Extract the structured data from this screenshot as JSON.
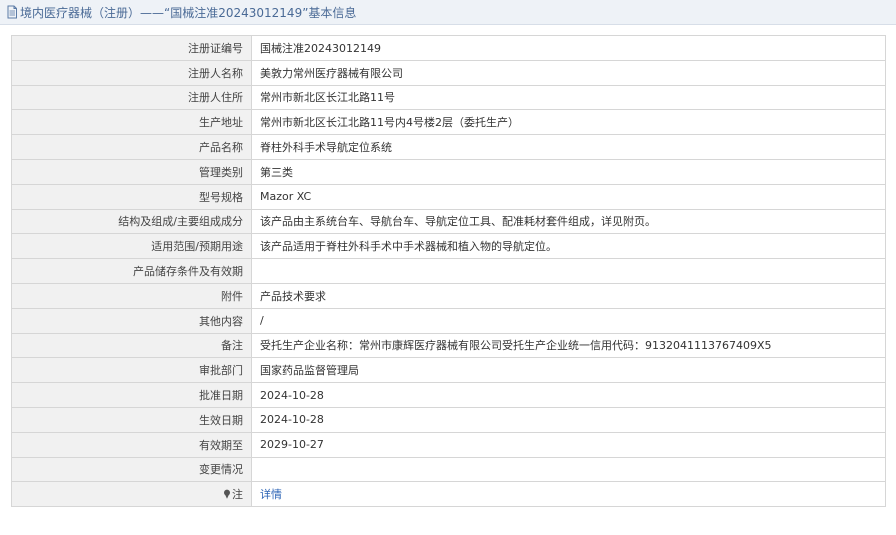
{
  "header": {
    "title": "境内医疗器械（注册）——“国械注准20243012149”基本信息"
  },
  "rows": [
    {
      "label": "注册证编号",
      "value": "国械注准20243012149"
    },
    {
      "label": "注册人名称",
      "value": "美敦力常州医疗器械有限公司"
    },
    {
      "label": "注册人住所",
      "value": "常州市新北区长江北路11号"
    },
    {
      "label": "生产地址",
      "value": "常州市新北区长江北路11号内4号楼2层（委托生产）"
    },
    {
      "label": "产品名称",
      "value": "脊柱外科手术导航定位系统"
    },
    {
      "label": "管理类别",
      "value": "第三类"
    },
    {
      "label": "型号规格",
      "value": "Mazor XC"
    },
    {
      "label": "结构及组成/主要组成成分",
      "value": "该产品由主系统台车、导航台车、导航定位工具、配准耗材套件组成，详见附页。"
    },
    {
      "label": "适用范围/预期用途",
      "value": "该产品适用于脊柱外科手术中手术器械和植入物的导航定位。"
    },
    {
      "label": "产品储存条件及有效期",
      "value": ""
    },
    {
      "label": "附件",
      "value": "产品技术要求"
    },
    {
      "label": "其他内容",
      "value": "/"
    },
    {
      "label": "备注",
      "value": "受托生产企业名称：常州市康辉医疗器械有限公司受托生产企业统一信用代码：9132041113767409X5"
    },
    {
      "label": "审批部门",
      "value": "国家药品监督管理局"
    },
    {
      "label": "批准日期",
      "value": "2024-10-28"
    },
    {
      "label": "生效日期",
      "value": "2024-10-28"
    },
    {
      "label": "有效期至",
      "value": "2029-10-27"
    },
    {
      "label": "变更情况",
      "value": ""
    }
  ],
  "note_row": {
    "label": "注",
    "link_text": "详情",
    "icon": "pin-icon"
  },
  "colors": {
    "header_bg": "#eef2f7",
    "header_text": "#4a6a96",
    "label_bg": "#f1f1f1",
    "border": "#d6d6d6",
    "link": "#2a62b5"
  }
}
